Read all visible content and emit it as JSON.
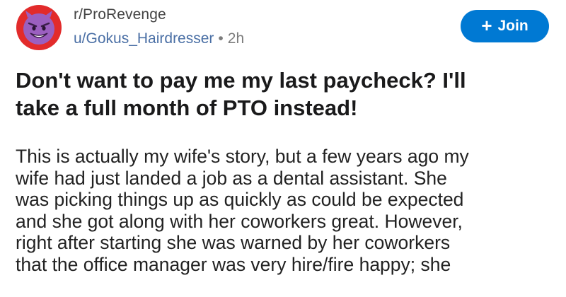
{
  "post": {
    "subreddit": "r/ProRevenge",
    "author": "u/Gokus_Hairdresser",
    "separator": "•",
    "time": "2h",
    "join_label": "Join",
    "join_icon": "plus-icon",
    "avatar_icon": "devil-face-icon",
    "title_lines": [
      "Don't want to pay me my last paycheck? I'll",
      "take a full month of PTO instead!"
    ],
    "body_lines": [
      "This is actually my wife's story, but a few years ago my",
      "wife had just landed a job as a dental assistant. She",
      "was picking things up as quickly as could be expected",
      "and she got along with her coworkers great. However,",
      "right after starting she was warned by her coworkers",
      "that the office manager was very hire/fire happy; she"
    ]
  },
  "colors": {
    "join_button": "#0079d3",
    "avatar_bg": "#e22b2b",
    "avatar_face": "#9b5fc0",
    "author_link": "#4a6fa5"
  }
}
